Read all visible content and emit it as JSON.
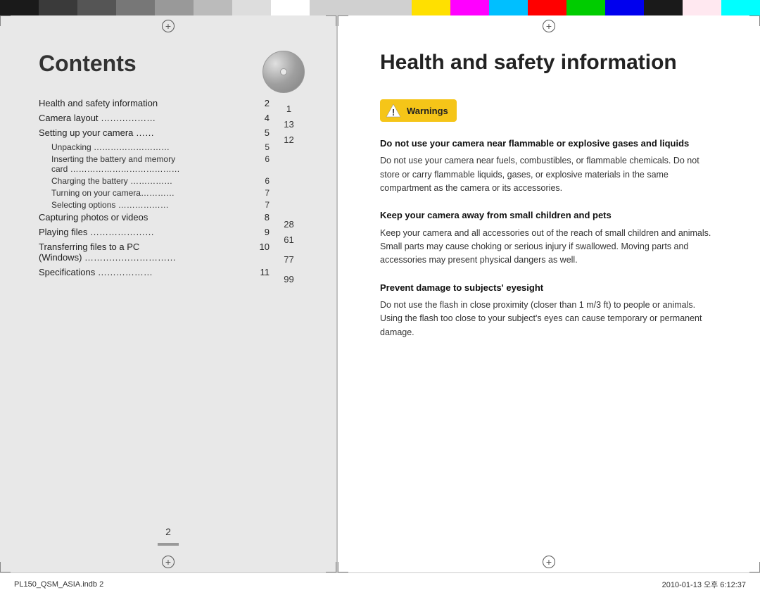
{
  "colors": {
    "leftBars": [
      "#1a1a1a",
      "#3a3a3a",
      "#555",
      "#777",
      "#999",
      "#bbb",
      "#ddd",
      "#fff"
    ],
    "rightBars": [
      "#ffe000",
      "#ff00ff",
      "#00bfff",
      "#ff0000",
      "#00cc00",
      "#0000ff",
      "#1a1a1a",
      "#ffe0f0",
      "#00ffff"
    ]
  },
  "leftPage": {
    "title": "Contents",
    "tocEntries": [
      {
        "label": "Health and safety information",
        "dots": true,
        "page": "2",
        "rightNum": "1",
        "level": "main"
      },
      {
        "label": "Camera layout  ………………",
        "page": "4",
        "rightNum": "13",
        "level": "main"
      },
      {
        "label": "Setting up your camera  ……",
        "page": "5",
        "rightNum": "12",
        "level": "main"
      },
      {
        "label": "Unpacking  ……………………",
        "page": "5",
        "rightNum": "",
        "level": "sub"
      },
      {
        "label": "Inserting the battery and memory card ………………………………",
        "page": "6",
        "rightNum": "",
        "level": "sub"
      },
      {
        "label": "Charging the battery  ……………",
        "page": "6",
        "rightNum": "",
        "level": "sub"
      },
      {
        "label": "Turning on your camera…………",
        "page": "7",
        "rightNum": "",
        "level": "sub"
      },
      {
        "label": "Selecting options   ………………",
        "page": "7",
        "rightNum": "",
        "level": "sub"
      },
      {
        "label": "Capturing photos or videos",
        "page": "8",
        "rightNum": "28",
        "level": "main"
      },
      {
        "label": "Playing files  …………………",
        "page": "9",
        "rightNum": "61",
        "level": "main"
      },
      {
        "label": "Transferring files to a PC (Windows)  …………………",
        "page": "10",
        "rightNum": "77",
        "level": "main"
      },
      {
        "label": "Specifications  ………………",
        "page": "11",
        "rightNum": "99",
        "level": "main"
      }
    ],
    "pageNumber": "2"
  },
  "rightPage": {
    "title": "Health and safety information",
    "warningLabel": "Warnings",
    "sections": [
      {
        "heading": "Do not use your camera near flammable or explosive gases and liquids",
        "body": "Do not use your camera near fuels, combustibles, or flammable chemicals. Do not store or carry flammable liquids, gases, or explosive materials in the same compartment as the camera or its accessories."
      },
      {
        "heading": "Keep your camera away from small children and pets",
        "body": "Keep your camera and all accessories out of the reach of small children and animals. Small parts may cause choking or serious injury if swallowed. Moving parts and accessories may present physical dangers as well."
      },
      {
        "heading": "Prevent damage to subjects' eyesight",
        "body": "Do not use the flash in close proximity (closer than 1 m/3 ft) to people or animals. Using the flash too close to your subject's eyes can cause temporary or permanent damage."
      }
    ]
  },
  "footer": {
    "leftText": "PL150_QSM_ASIA.indb   2",
    "rightText": "2010-01-13   오후 6:12:37"
  }
}
